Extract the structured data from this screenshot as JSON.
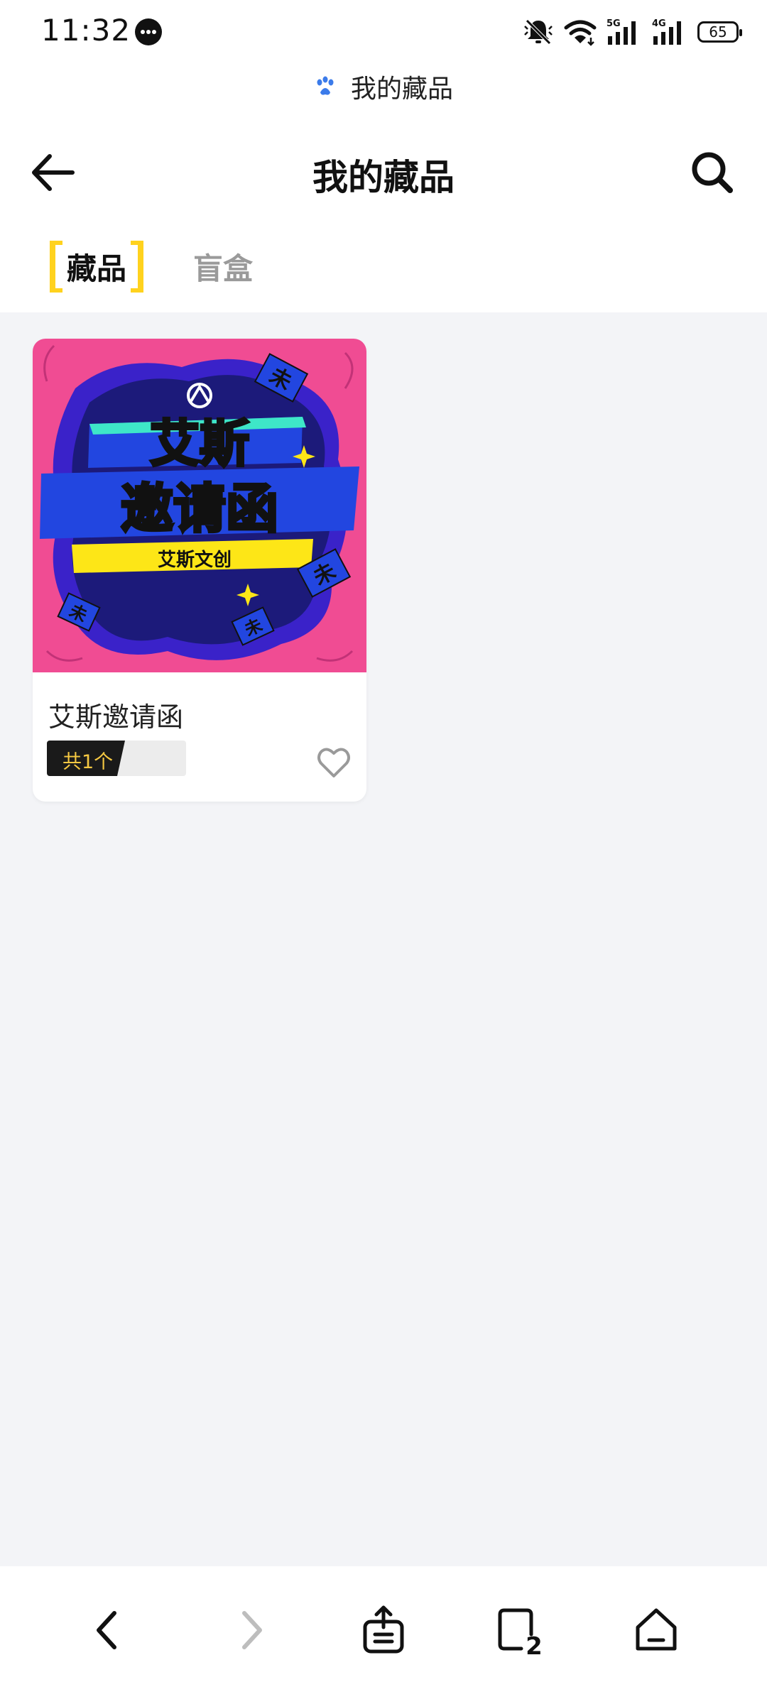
{
  "status_bar": {
    "time": "11:32",
    "battery": "65",
    "net_5g": "5G",
    "net_4g": "4G"
  },
  "site_header": {
    "icon": "paw-icon",
    "title": "我的藏品"
  },
  "nav": {
    "title": "我的藏品",
    "back_icon": "arrow-left-icon",
    "search_icon": "search-icon"
  },
  "tabs": [
    {
      "label": "藏品",
      "active": true
    },
    {
      "label": "盲盒",
      "active": false
    }
  ],
  "collection": {
    "items": [
      {
        "image": {
          "line1": "艾斯",
          "line2": "邀请函",
          "ribbon": "艾斯文创",
          "stamp": "未"
        },
        "name": "艾斯邀请函",
        "count_label": "共1个",
        "favorite_icon": "heart-outline-icon"
      }
    ]
  },
  "colors": {
    "accent": "#ffd21e",
    "background": "#f3f4f7",
    "card_bg": "#ffffff",
    "image_pink": "#f04c93",
    "image_navy": "#1c1a7a",
    "image_blue": "#2246e0",
    "image_yellow": "#fde617",
    "image_teal": "#3ee6c8",
    "inactive_tab": "#9a9a9a"
  },
  "bottom_bar": {
    "back_icon": "chevron-left-icon",
    "forward_icon": "chevron-right-icon",
    "share_icon": "share-icon",
    "tabs_icon": "tabs-icon",
    "tabs_count": "2",
    "home_icon": "home-icon"
  }
}
